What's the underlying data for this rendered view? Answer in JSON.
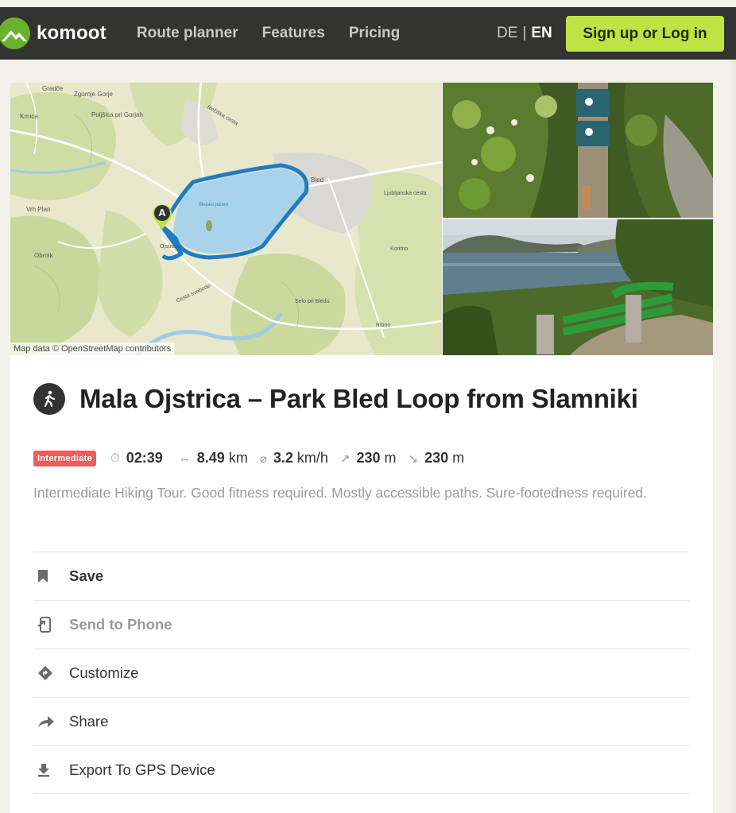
{
  "nav": {
    "brand": "komoot",
    "links": [
      "Route planner",
      "Features",
      "Pricing"
    ],
    "lang_de": "DE",
    "lang_sep": "|",
    "lang_en": "EN",
    "signup": "Sign up or Log in"
  },
  "map": {
    "credit": "Map data © OpenStreetMap contributors",
    "start_marker": "A",
    "places": [
      "Gradče",
      "Zgornje Gorje",
      "Krnica",
      "Poljšica pri Gorjah",
      "Bled",
      "Ljubljanska cesta",
      "Bohinjska cesta",
      "Blejsko jezero",
      "Vrh Plan",
      "Obrnik",
      "Ojstrica",
      "Cesta svobode",
      "Selo pri Bledu",
      "Ribno",
      "Koritno",
      "Rečiška cesta"
    ]
  },
  "tour": {
    "title": "Mala Ojstrica – Park Bled Loop from Slamniki",
    "difficulty": "Intermediate",
    "duration": "02:39",
    "distance": "8.49",
    "distance_unit": "km",
    "speed": "3.2",
    "speed_unit": "km/h",
    "uphill": "230",
    "uphill_unit": "m",
    "downhill": "230",
    "downhill_unit": "m",
    "description": "Intermediate Hiking Tour. Good fitness required. Mostly accessible paths. Sure-footedness required."
  },
  "actions": [
    {
      "label": "Save",
      "icon": "bookmark-icon"
    },
    {
      "label": "Send to Phone",
      "icon": "phone-send-icon"
    },
    {
      "label": "Customize",
      "icon": "route-sign-icon"
    },
    {
      "label": "Share",
      "icon": "share-arrow-icon"
    },
    {
      "label": "Export To GPS Device",
      "icon": "download-icon"
    }
  ],
  "colors": {
    "nav_bg": "#333432",
    "accent_green": "#bee342",
    "route_blue": "#1f7bc2",
    "badge_red": "#f15b5b"
  }
}
